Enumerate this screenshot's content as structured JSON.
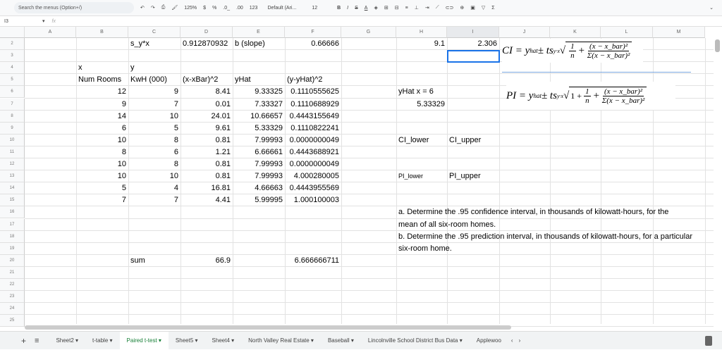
{
  "toolbar": {
    "search_placeholder": "Search the menus (Option+/)",
    "zoom": "125%",
    "currency": "$",
    "percent": "%",
    "dec_less": ".0_",
    "dec_more": ".00",
    "format": "123",
    "font": "Default (Ari...",
    "font_size": "12",
    "bold": "B",
    "italic": "I",
    "strike": "S",
    "text_color": "A",
    "sum": "Σ"
  },
  "formula_bar": {
    "cell_ref": "I3",
    "fx": "fx",
    "value": ""
  },
  "columns": [
    "A",
    "B",
    "C",
    "D",
    "E",
    "F",
    "G",
    "H",
    "I",
    "J",
    "K",
    "L",
    "M"
  ],
  "rows": [
    "2",
    "3",
    "4",
    "5",
    "6",
    "7",
    "8",
    "9",
    "10",
    "11",
    "12",
    "13",
    "14",
    "15",
    "16",
    "17",
    "18",
    "19",
    "20",
    "21",
    "22",
    "23",
    "24",
    "25"
  ],
  "cells": [
    {
      "r": 2,
      "c": 2,
      "v": "s_y*x",
      "a": "l"
    },
    {
      "r": 2,
      "c": 3,
      "v": "0.912870932",
      "a": "l"
    },
    {
      "r": 2,
      "c": 4,
      "v": "b (slope)",
      "a": "l"
    },
    {
      "r": 2,
      "c": 5,
      "v": "0.66666",
      "a": "r"
    },
    {
      "r": 2,
      "c": 7,
      "v": "9.1",
      "a": "r"
    },
    {
      "r": 2,
      "c": 8,
      "v": "2.306",
      "a": "r"
    },
    {
      "r": 4,
      "c": 1,
      "v": "x",
      "a": "l"
    },
    {
      "r": 4,
      "c": 2,
      "v": "y",
      "a": "l"
    },
    {
      "r": 5,
      "c": 1,
      "v": "Num Rooms",
      "a": "l"
    },
    {
      "r": 5,
      "c": 2,
      "v": "KwH (000)",
      "a": "l"
    },
    {
      "r": 5,
      "c": 3,
      "v": "(x-xBar)^2",
      "a": "l"
    },
    {
      "r": 5,
      "c": 4,
      "v": "yHat",
      "a": "l"
    },
    {
      "r": 5,
      "c": 5,
      "v": "(y-yHat)^2",
      "a": "l"
    },
    {
      "r": 6,
      "c": 1,
      "v": "12",
      "a": "r"
    },
    {
      "r": 6,
      "c": 2,
      "v": "9",
      "a": "r"
    },
    {
      "r": 6,
      "c": 3,
      "v": "8.41",
      "a": "r"
    },
    {
      "r": 6,
      "c": 4,
      "v": "9.33325",
      "a": "r"
    },
    {
      "r": 6,
      "c": 5,
      "v": "0.1110555625",
      "a": "r"
    },
    {
      "r": 7,
      "c": 1,
      "v": "9",
      "a": "r"
    },
    {
      "r": 7,
      "c": 2,
      "v": "7",
      "a": "r"
    },
    {
      "r": 7,
      "c": 3,
      "v": "0.01",
      "a": "r"
    },
    {
      "r": 7,
      "c": 4,
      "v": "7.33327",
      "a": "r"
    },
    {
      "r": 7,
      "c": 5,
      "v": "0.1110688929",
      "a": "r"
    },
    {
      "r": 8,
      "c": 1,
      "v": "14",
      "a": "r"
    },
    {
      "r": 8,
      "c": 2,
      "v": "10",
      "a": "r"
    },
    {
      "r": 8,
      "c": 3,
      "v": "24.01",
      "a": "r"
    },
    {
      "r": 8,
      "c": 4,
      "v": "10.66657",
      "a": "r"
    },
    {
      "r": 8,
      "c": 5,
      "v": "0.4443155649",
      "a": "r"
    },
    {
      "r": 9,
      "c": 1,
      "v": "6",
      "a": "r"
    },
    {
      "r": 9,
      "c": 2,
      "v": "5",
      "a": "r"
    },
    {
      "r": 9,
      "c": 3,
      "v": "9.61",
      "a": "r"
    },
    {
      "r": 9,
      "c": 4,
      "v": "5.33329",
      "a": "r"
    },
    {
      "r": 9,
      "c": 5,
      "v": "0.1110822241",
      "a": "r"
    },
    {
      "r": 10,
      "c": 1,
      "v": "10",
      "a": "r"
    },
    {
      "r": 10,
      "c": 2,
      "v": "8",
      "a": "r"
    },
    {
      "r": 10,
      "c": 3,
      "v": "0.81",
      "a": "r"
    },
    {
      "r": 10,
      "c": 4,
      "v": "7.99993",
      "a": "r"
    },
    {
      "r": 10,
      "c": 5,
      "v": "0.0000000049",
      "a": "r"
    },
    {
      "r": 11,
      "c": 1,
      "v": "8",
      "a": "r"
    },
    {
      "r": 11,
      "c": 2,
      "v": "6",
      "a": "r"
    },
    {
      "r": 11,
      "c": 3,
      "v": "1.21",
      "a": "r"
    },
    {
      "r": 11,
      "c": 4,
      "v": "6.66661",
      "a": "r"
    },
    {
      "r": 11,
      "c": 5,
      "v": "0.4443688921",
      "a": "r"
    },
    {
      "r": 12,
      "c": 1,
      "v": "10",
      "a": "r"
    },
    {
      "r": 12,
      "c": 2,
      "v": "8",
      "a": "r"
    },
    {
      "r": 12,
      "c": 3,
      "v": "0.81",
      "a": "r"
    },
    {
      "r": 12,
      "c": 4,
      "v": "7.99993",
      "a": "r"
    },
    {
      "r": 12,
      "c": 5,
      "v": "0.0000000049",
      "a": "r"
    },
    {
      "r": 13,
      "c": 1,
      "v": "10",
      "a": "r"
    },
    {
      "r": 13,
      "c": 2,
      "v": "10",
      "a": "r"
    },
    {
      "r": 13,
      "c": 3,
      "v": "0.81",
      "a": "r"
    },
    {
      "r": 13,
      "c": 4,
      "v": "7.99993",
      "a": "r"
    },
    {
      "r": 13,
      "c": 5,
      "v": "4.000280005",
      "a": "r"
    },
    {
      "r": 14,
      "c": 1,
      "v": "5",
      "a": "r"
    },
    {
      "r": 14,
      "c": 2,
      "v": "4",
      "a": "r"
    },
    {
      "r": 14,
      "c": 3,
      "v": "16.81",
      "a": "r"
    },
    {
      "r": 14,
      "c": 4,
      "v": "4.66663",
      "a": "r"
    },
    {
      "r": 14,
      "c": 5,
      "v": "0.4443955569",
      "a": "r"
    },
    {
      "r": 15,
      "c": 1,
      "v": "7",
      "a": "r"
    },
    {
      "r": 15,
      "c": 2,
      "v": "7",
      "a": "r"
    },
    {
      "r": 15,
      "c": 3,
      "v": "4.41",
      "a": "r"
    },
    {
      "r": 15,
      "c": 4,
      "v": "5.99995",
      "a": "r"
    },
    {
      "r": 15,
      "c": 5,
      "v": "1.000100003",
      "a": "r"
    },
    {
      "r": 20,
      "c": 2,
      "v": "sum",
      "a": "l"
    },
    {
      "r": 20,
      "c": 3,
      "v": "66.9",
      "a": "r"
    },
    {
      "r": 20,
      "c": 5,
      "v": "6.666666711",
      "a": "r"
    },
    {
      "r": 6,
      "c": 7,
      "v": "yHat x = 6",
      "a": "l"
    },
    {
      "r": 7,
      "c": 7,
      "v": "5.33329",
      "a": "r"
    },
    {
      "r": 10,
      "c": 7,
      "v": "CI_lower",
      "a": "l"
    },
    {
      "r": 10,
      "c": 8,
      "v": "CI_upper",
      "a": "l"
    },
    {
      "r": 13,
      "c": 7,
      "v": "PI_lower",
      "a": "l",
      "small": true
    },
    {
      "r": 13,
      "c": 8,
      "v": "PI_upper",
      "a": "l"
    },
    {
      "r": 16,
      "c": 7,
      "v": "a. Determine the .95 confidence interval, in thousands of kilowatt-hours, for the",
      "a": "l"
    },
    {
      "r": 17,
      "c": 7,
      "v": "mean of all six-room homes.",
      "a": "l"
    },
    {
      "r": 18,
      "c": 7,
      "v": "b. Determine the .95 prediction interval, in thousands of kilowatt-hours, for a particular",
      "a": "l"
    },
    {
      "r": 19,
      "c": 7,
      "v": "six-room home.",
      "a": "l"
    }
  ],
  "formulas": {
    "ci_lhs": "CI = y",
    "hat": "hat",
    "pm": " ± ts",
    "yx": "y·x",
    "one_over_n_num": "1",
    "one_over_n_den": "n",
    "plus": "+",
    "num": "(x − x_bar)²",
    "den": "Σ(x − x_bar)²",
    "pi_lhs": "PI = y",
    "one": "1 +"
  },
  "sheet_tabs": [
    {
      "label": "Sheet2"
    },
    {
      "label": "t-table"
    },
    {
      "label": "Paired t-test",
      "active": true
    },
    {
      "label": "Sheet5"
    },
    {
      "label": "Sheet4"
    },
    {
      "label": "North Valley Real Estate"
    },
    {
      "label": "Baseball"
    },
    {
      "label": "Lincolnville School District Bus Data"
    },
    {
      "label": "Applewoo"
    }
  ],
  "icons": {
    "add": "+",
    "list": "≡",
    "prev": "‹",
    "next": "›"
  }
}
